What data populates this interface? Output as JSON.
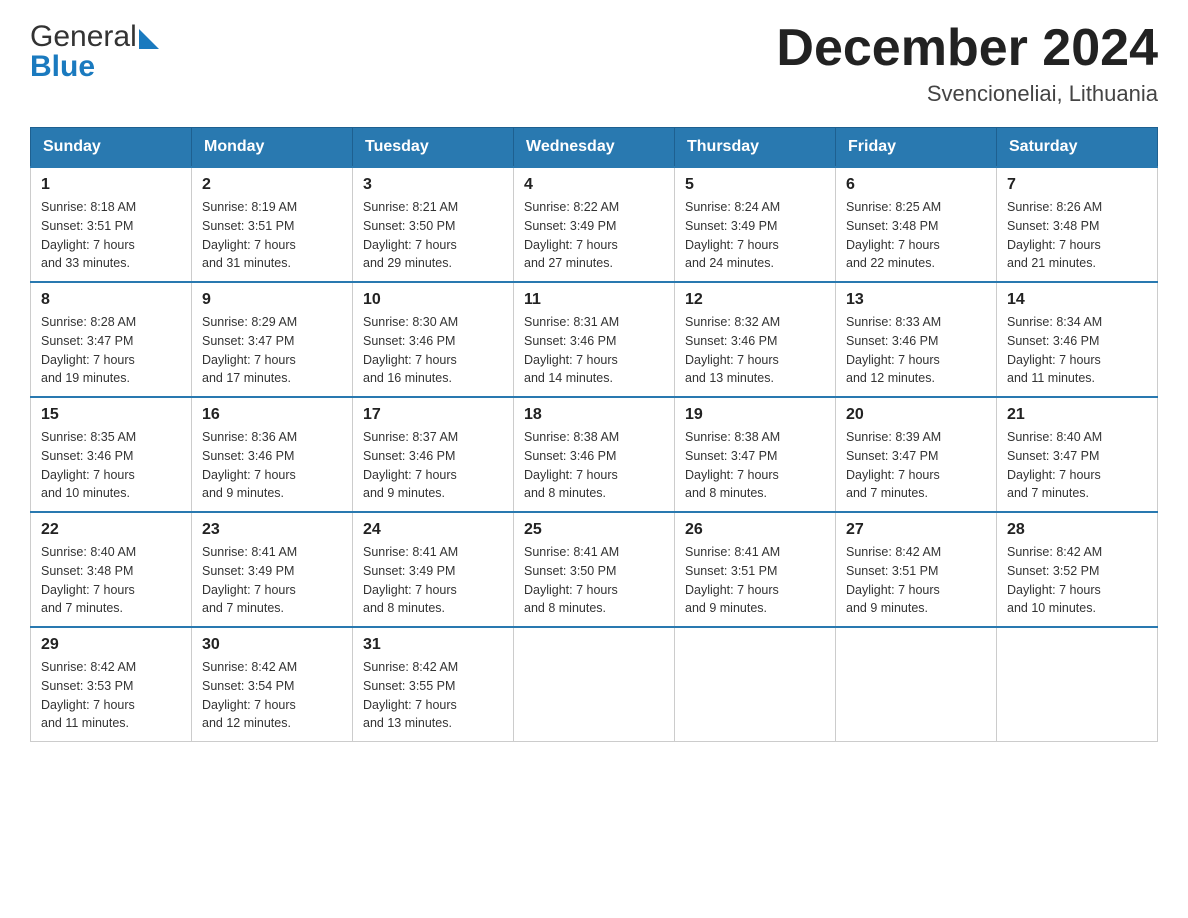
{
  "header": {
    "logo_general": "General",
    "logo_blue": "Blue",
    "month_title": "December 2024",
    "location": "Svencioneliai, Lithuania"
  },
  "days_of_week": [
    "Sunday",
    "Monday",
    "Tuesday",
    "Wednesday",
    "Thursday",
    "Friday",
    "Saturday"
  ],
  "weeks": [
    [
      {
        "day": "1",
        "info": "Sunrise: 8:18 AM\nSunset: 3:51 PM\nDaylight: 7 hours\nand 33 minutes."
      },
      {
        "day": "2",
        "info": "Sunrise: 8:19 AM\nSunset: 3:51 PM\nDaylight: 7 hours\nand 31 minutes."
      },
      {
        "day": "3",
        "info": "Sunrise: 8:21 AM\nSunset: 3:50 PM\nDaylight: 7 hours\nand 29 minutes."
      },
      {
        "day": "4",
        "info": "Sunrise: 8:22 AM\nSunset: 3:49 PM\nDaylight: 7 hours\nand 27 minutes."
      },
      {
        "day": "5",
        "info": "Sunrise: 8:24 AM\nSunset: 3:49 PM\nDaylight: 7 hours\nand 24 minutes."
      },
      {
        "day": "6",
        "info": "Sunrise: 8:25 AM\nSunset: 3:48 PM\nDaylight: 7 hours\nand 22 minutes."
      },
      {
        "day": "7",
        "info": "Sunrise: 8:26 AM\nSunset: 3:48 PM\nDaylight: 7 hours\nand 21 minutes."
      }
    ],
    [
      {
        "day": "8",
        "info": "Sunrise: 8:28 AM\nSunset: 3:47 PM\nDaylight: 7 hours\nand 19 minutes."
      },
      {
        "day": "9",
        "info": "Sunrise: 8:29 AM\nSunset: 3:47 PM\nDaylight: 7 hours\nand 17 minutes."
      },
      {
        "day": "10",
        "info": "Sunrise: 8:30 AM\nSunset: 3:46 PM\nDaylight: 7 hours\nand 16 minutes."
      },
      {
        "day": "11",
        "info": "Sunrise: 8:31 AM\nSunset: 3:46 PM\nDaylight: 7 hours\nand 14 minutes."
      },
      {
        "day": "12",
        "info": "Sunrise: 8:32 AM\nSunset: 3:46 PM\nDaylight: 7 hours\nand 13 minutes."
      },
      {
        "day": "13",
        "info": "Sunrise: 8:33 AM\nSunset: 3:46 PM\nDaylight: 7 hours\nand 12 minutes."
      },
      {
        "day": "14",
        "info": "Sunrise: 8:34 AM\nSunset: 3:46 PM\nDaylight: 7 hours\nand 11 minutes."
      }
    ],
    [
      {
        "day": "15",
        "info": "Sunrise: 8:35 AM\nSunset: 3:46 PM\nDaylight: 7 hours\nand 10 minutes."
      },
      {
        "day": "16",
        "info": "Sunrise: 8:36 AM\nSunset: 3:46 PM\nDaylight: 7 hours\nand 9 minutes."
      },
      {
        "day": "17",
        "info": "Sunrise: 8:37 AM\nSunset: 3:46 PM\nDaylight: 7 hours\nand 9 minutes."
      },
      {
        "day": "18",
        "info": "Sunrise: 8:38 AM\nSunset: 3:46 PM\nDaylight: 7 hours\nand 8 minutes."
      },
      {
        "day": "19",
        "info": "Sunrise: 8:38 AM\nSunset: 3:47 PM\nDaylight: 7 hours\nand 8 minutes."
      },
      {
        "day": "20",
        "info": "Sunrise: 8:39 AM\nSunset: 3:47 PM\nDaylight: 7 hours\nand 7 minutes."
      },
      {
        "day": "21",
        "info": "Sunrise: 8:40 AM\nSunset: 3:47 PM\nDaylight: 7 hours\nand 7 minutes."
      }
    ],
    [
      {
        "day": "22",
        "info": "Sunrise: 8:40 AM\nSunset: 3:48 PM\nDaylight: 7 hours\nand 7 minutes."
      },
      {
        "day": "23",
        "info": "Sunrise: 8:41 AM\nSunset: 3:49 PM\nDaylight: 7 hours\nand 7 minutes."
      },
      {
        "day": "24",
        "info": "Sunrise: 8:41 AM\nSunset: 3:49 PM\nDaylight: 7 hours\nand 8 minutes."
      },
      {
        "day": "25",
        "info": "Sunrise: 8:41 AM\nSunset: 3:50 PM\nDaylight: 7 hours\nand 8 minutes."
      },
      {
        "day": "26",
        "info": "Sunrise: 8:41 AM\nSunset: 3:51 PM\nDaylight: 7 hours\nand 9 minutes."
      },
      {
        "day": "27",
        "info": "Sunrise: 8:42 AM\nSunset: 3:51 PM\nDaylight: 7 hours\nand 9 minutes."
      },
      {
        "day": "28",
        "info": "Sunrise: 8:42 AM\nSunset: 3:52 PM\nDaylight: 7 hours\nand 10 minutes."
      }
    ],
    [
      {
        "day": "29",
        "info": "Sunrise: 8:42 AM\nSunset: 3:53 PM\nDaylight: 7 hours\nand 11 minutes."
      },
      {
        "day": "30",
        "info": "Sunrise: 8:42 AM\nSunset: 3:54 PM\nDaylight: 7 hours\nand 12 minutes."
      },
      {
        "day": "31",
        "info": "Sunrise: 8:42 AM\nSunset: 3:55 PM\nDaylight: 7 hours\nand 13 minutes."
      },
      {
        "day": "",
        "info": ""
      },
      {
        "day": "",
        "info": ""
      },
      {
        "day": "",
        "info": ""
      },
      {
        "day": "",
        "info": ""
      }
    ]
  ]
}
